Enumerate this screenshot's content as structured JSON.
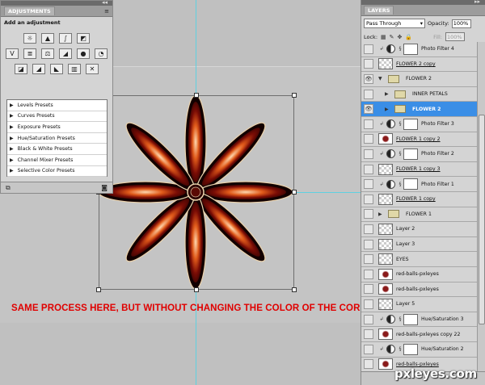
{
  "adjustments": {
    "tab": "ADJUSTMENTS",
    "title": "Add an adjustment",
    "presets": [
      "Levels Presets",
      "Curves Presets",
      "Exposure Presets",
      "Hue/Saturation Presets",
      "Black & White Presets",
      "Channel Mixer Presets",
      "Selective Color Presets"
    ],
    "icons_row1": [
      "brightness-icon",
      "levels-icon",
      "curves-icon",
      "exposure-icon"
    ],
    "icons_row2": [
      "vibrance-icon",
      "hue-sat-icon",
      "color-balance-icon",
      "bw-icon",
      "photo-filter-icon",
      "channel-mixer-icon"
    ],
    "icons_row3": [
      "invert-icon",
      "posterize-icon",
      "threshold-icon",
      "gradient-map-icon",
      "selective-color-icon"
    ]
  },
  "layers": {
    "tab": "LAYERS",
    "blend_mode": "Pass Through",
    "opacity_label": "Opacity:",
    "opacity_value": "100%",
    "lock_label": "Lock:",
    "fill_label": "Fill:",
    "fill_value": "100%",
    "rows": [
      {
        "name": "Photo Filter 4",
        "kind": "adjustment",
        "visible": false
      },
      {
        "name": "FLOWER 2 copy",
        "kind": "pixel",
        "visible": false,
        "link": true
      },
      {
        "name": "FLOWER 2",
        "kind": "group",
        "visible": true,
        "open": true
      },
      {
        "name": "INNER PETALS",
        "kind": "group",
        "visible": false,
        "indent": true
      },
      {
        "name": "FLOWER 2",
        "kind": "group",
        "visible": true,
        "selected": true,
        "indent": true
      },
      {
        "name": "Photo Filter 3",
        "kind": "adjustment",
        "visible": false
      },
      {
        "name": "FLOWER 1 copy 2",
        "kind": "pixel",
        "visible": false,
        "link": true,
        "flower": true
      },
      {
        "name": "Photo Filter 2",
        "kind": "adjustment",
        "visible": false
      },
      {
        "name": "FLOWER 1 copy 3",
        "kind": "pixel",
        "visible": false,
        "link": true
      },
      {
        "name": "Photo Filter 1",
        "kind": "adjustment",
        "visible": false
      },
      {
        "name": "FLOWER 1 copy",
        "kind": "pixel",
        "visible": false,
        "link": true
      },
      {
        "name": "FLOWER 1",
        "kind": "group",
        "visible": false
      },
      {
        "name": "Layer 2",
        "kind": "pixel",
        "visible": false
      },
      {
        "name": "Layer 3",
        "kind": "pixel",
        "visible": false
      },
      {
        "name": "EYES",
        "kind": "pixel",
        "visible": false
      },
      {
        "name": "red-balls-pxleyes",
        "kind": "pixel",
        "visible": false,
        "flower": true
      },
      {
        "name": "red-balls-pxleyes",
        "kind": "pixel",
        "visible": false,
        "flower": true
      },
      {
        "name": "Layer 5",
        "kind": "pixel",
        "visible": false
      },
      {
        "name": "Hue/Saturation 3",
        "kind": "adjustment",
        "visible": false
      },
      {
        "name": "red-balls-pxleyes copy 22",
        "kind": "pixel",
        "visible": false,
        "flower": true
      },
      {
        "name": "Hue/Saturation 2",
        "kind": "adjustment",
        "visible": false
      },
      {
        "name": "red-balls-pxleyes",
        "kind": "pixel",
        "visible": false,
        "link": true,
        "flower": true
      }
    ]
  },
  "canvas": {
    "caption": "SAME PROCESS HERE, BUT WITHOUT CHANGING THE COLOR OF THE CORE.",
    "caption_color": "#e00000",
    "guide_color": "#5fd0e0"
  },
  "watermark": "pxleyes.com",
  "colors": {
    "selected_row": "#3a8ee6",
    "panel_bg": "#d4d4d4"
  }
}
